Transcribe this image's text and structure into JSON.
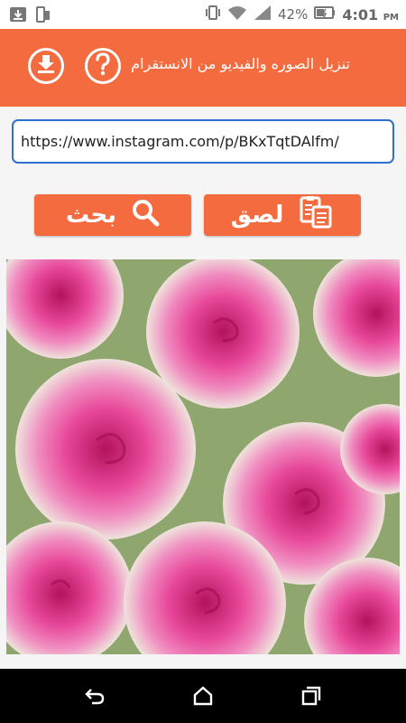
{
  "status_bar": {
    "battery_percent": "42%",
    "time": "4:01",
    "ampm": "PM"
  },
  "app_bar": {
    "title": "تنزيل الصوره والفيديو من الانستقرام",
    "help_icon": "question-icon",
    "download_icon": "download-icon",
    "accent_color": "#f36b3f"
  },
  "url_field": {
    "value": "https://www.instagram.com/p/BKxTqtDAlfm/"
  },
  "buttons": {
    "paste_label": "لصق",
    "search_label": "بحث"
  },
  "preview": {
    "subject": "pink roses photo"
  }
}
